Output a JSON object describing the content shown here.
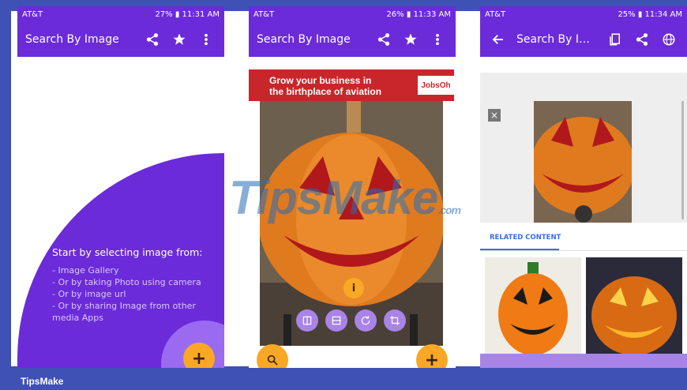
{
  "brand_footer": "TipsMake",
  "watermark": {
    "main": "TipsMake",
    "suffix": ".com"
  },
  "phone1": {
    "status": {
      "carrier": "AT&T",
      "right": "27% ▮ 11:31 AM"
    },
    "title": "Search By Image",
    "intro_heading": "Start by selecting image from:",
    "intro_items": [
      "- Image Gallery",
      "- Or by taking Photo using camera",
      "- Or by image url",
      "- Or by sharing Image from other",
      "media Apps"
    ],
    "fab_label": "+"
  },
  "phone2": {
    "status": {
      "carrier": "AT&T",
      "right": "26% ▮ 11:33 AM"
    },
    "title": "Search By Image",
    "ad_line1": "Grow your business in",
    "ad_line2": "the birthplace of aviation",
    "ad_brand": "JobsOh",
    "info_label": "i",
    "search_fab": "search-icon",
    "add_fab": "+"
  },
  "phone3": {
    "status": {
      "carrier": "AT&T",
      "right": "25% ▮ 11:34 AM"
    },
    "title": "Search By Im...",
    "close_label": "×",
    "tab_label": "RELATED CONTENT"
  },
  "colors": {
    "accent": "#6c2bd9",
    "fab": "#f9a825",
    "frame": "#3f51b5"
  }
}
